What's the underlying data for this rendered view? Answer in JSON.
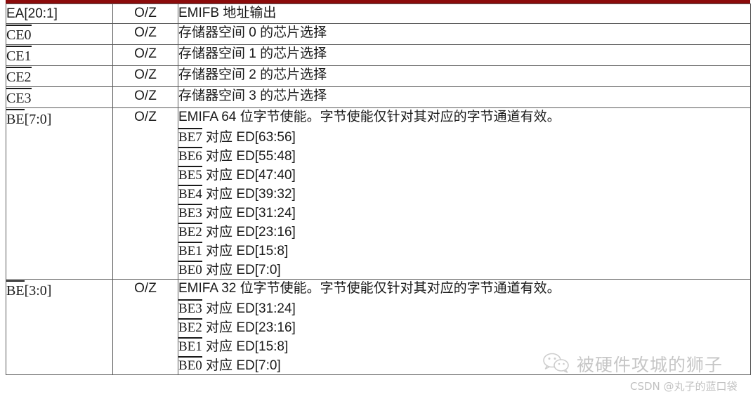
{
  "document": {
    "type": "signal-description-table",
    "accent_color": "#8B0B0B",
    "border_color": "#595959",
    "text_color": "#1a1a1a"
  },
  "table": {
    "rows": [
      {
        "name": "EA[20:1]",
        "name_overline": "",
        "name_tail": "EA[20:1]",
        "type": "O/Z",
        "description": "EMIFB 地址输出",
        "sublines": []
      },
      {
        "name": "CE0",
        "name_overline": "CE0",
        "name_tail": "",
        "type": "O/Z",
        "description": "存储器空间 0 的芯片选择",
        "sublines": []
      },
      {
        "name": "CE1",
        "name_overline": "CE1",
        "name_tail": "",
        "type": "O/Z",
        "description": "存储器空间 1 的芯片选择",
        "sublines": []
      },
      {
        "name": "CE2",
        "name_overline": "CE2",
        "name_tail": "",
        "type": "O/Z",
        "description": "存储器空间 2 的芯片选择",
        "sublines": []
      },
      {
        "name": "CE3",
        "name_overline": "CE3",
        "name_tail": "",
        "type": "O/Z",
        "description": "存储器空间 3 的芯片选择",
        "sublines": []
      },
      {
        "name": "BE[7:0]",
        "name_overline": "BE",
        "name_tail": "[7:0]",
        "type": "O/Z",
        "description": "EMIFA 64 位字节使能。字节使能仅针对其对应的字节通道有效。",
        "sublines": [
          {
            "overline": "BE7",
            "tail": " 对应 ED[63:56]"
          },
          {
            "overline": "BE6",
            "tail": " 对应 ED[55:48]"
          },
          {
            "overline": "BE5",
            "tail": " 对应 ED[47:40]"
          },
          {
            "overline": "BE4",
            "tail": " 对应 ED[39:32]"
          },
          {
            "overline": "BE3",
            "tail": " 对应 ED[31:24]"
          },
          {
            "overline": "BE2",
            "tail": " 对应 ED[23:16]"
          },
          {
            "overline": "BE1",
            "tail": " 对应 ED[15:8]"
          },
          {
            "overline": "BE0",
            "tail": " 对应 ED[7:0]"
          }
        ]
      },
      {
        "name": "BE[3:0]",
        "name_overline": "BE",
        "name_tail": "[3:0]",
        "type": "O/Z",
        "description": "EMIFA 32 位字节使能。字节使能仅针对其对应的字节通道有效。",
        "sublines": [
          {
            "overline": "BE3",
            "tail": " 对应 ED[31:24]"
          },
          {
            "overline": "BE2",
            "tail": " 对应 ED[23:16]"
          },
          {
            "overline": "BE1",
            "tail": " 对应 ED[15:8]"
          },
          {
            "overline": "BE0",
            "tail": " 对应 ED[7:0]"
          }
        ]
      }
    ]
  },
  "watermarks": {
    "wechat_account": "被硬件攻城的狮子",
    "csdn": "CSDN @丸子的蓝口袋"
  }
}
